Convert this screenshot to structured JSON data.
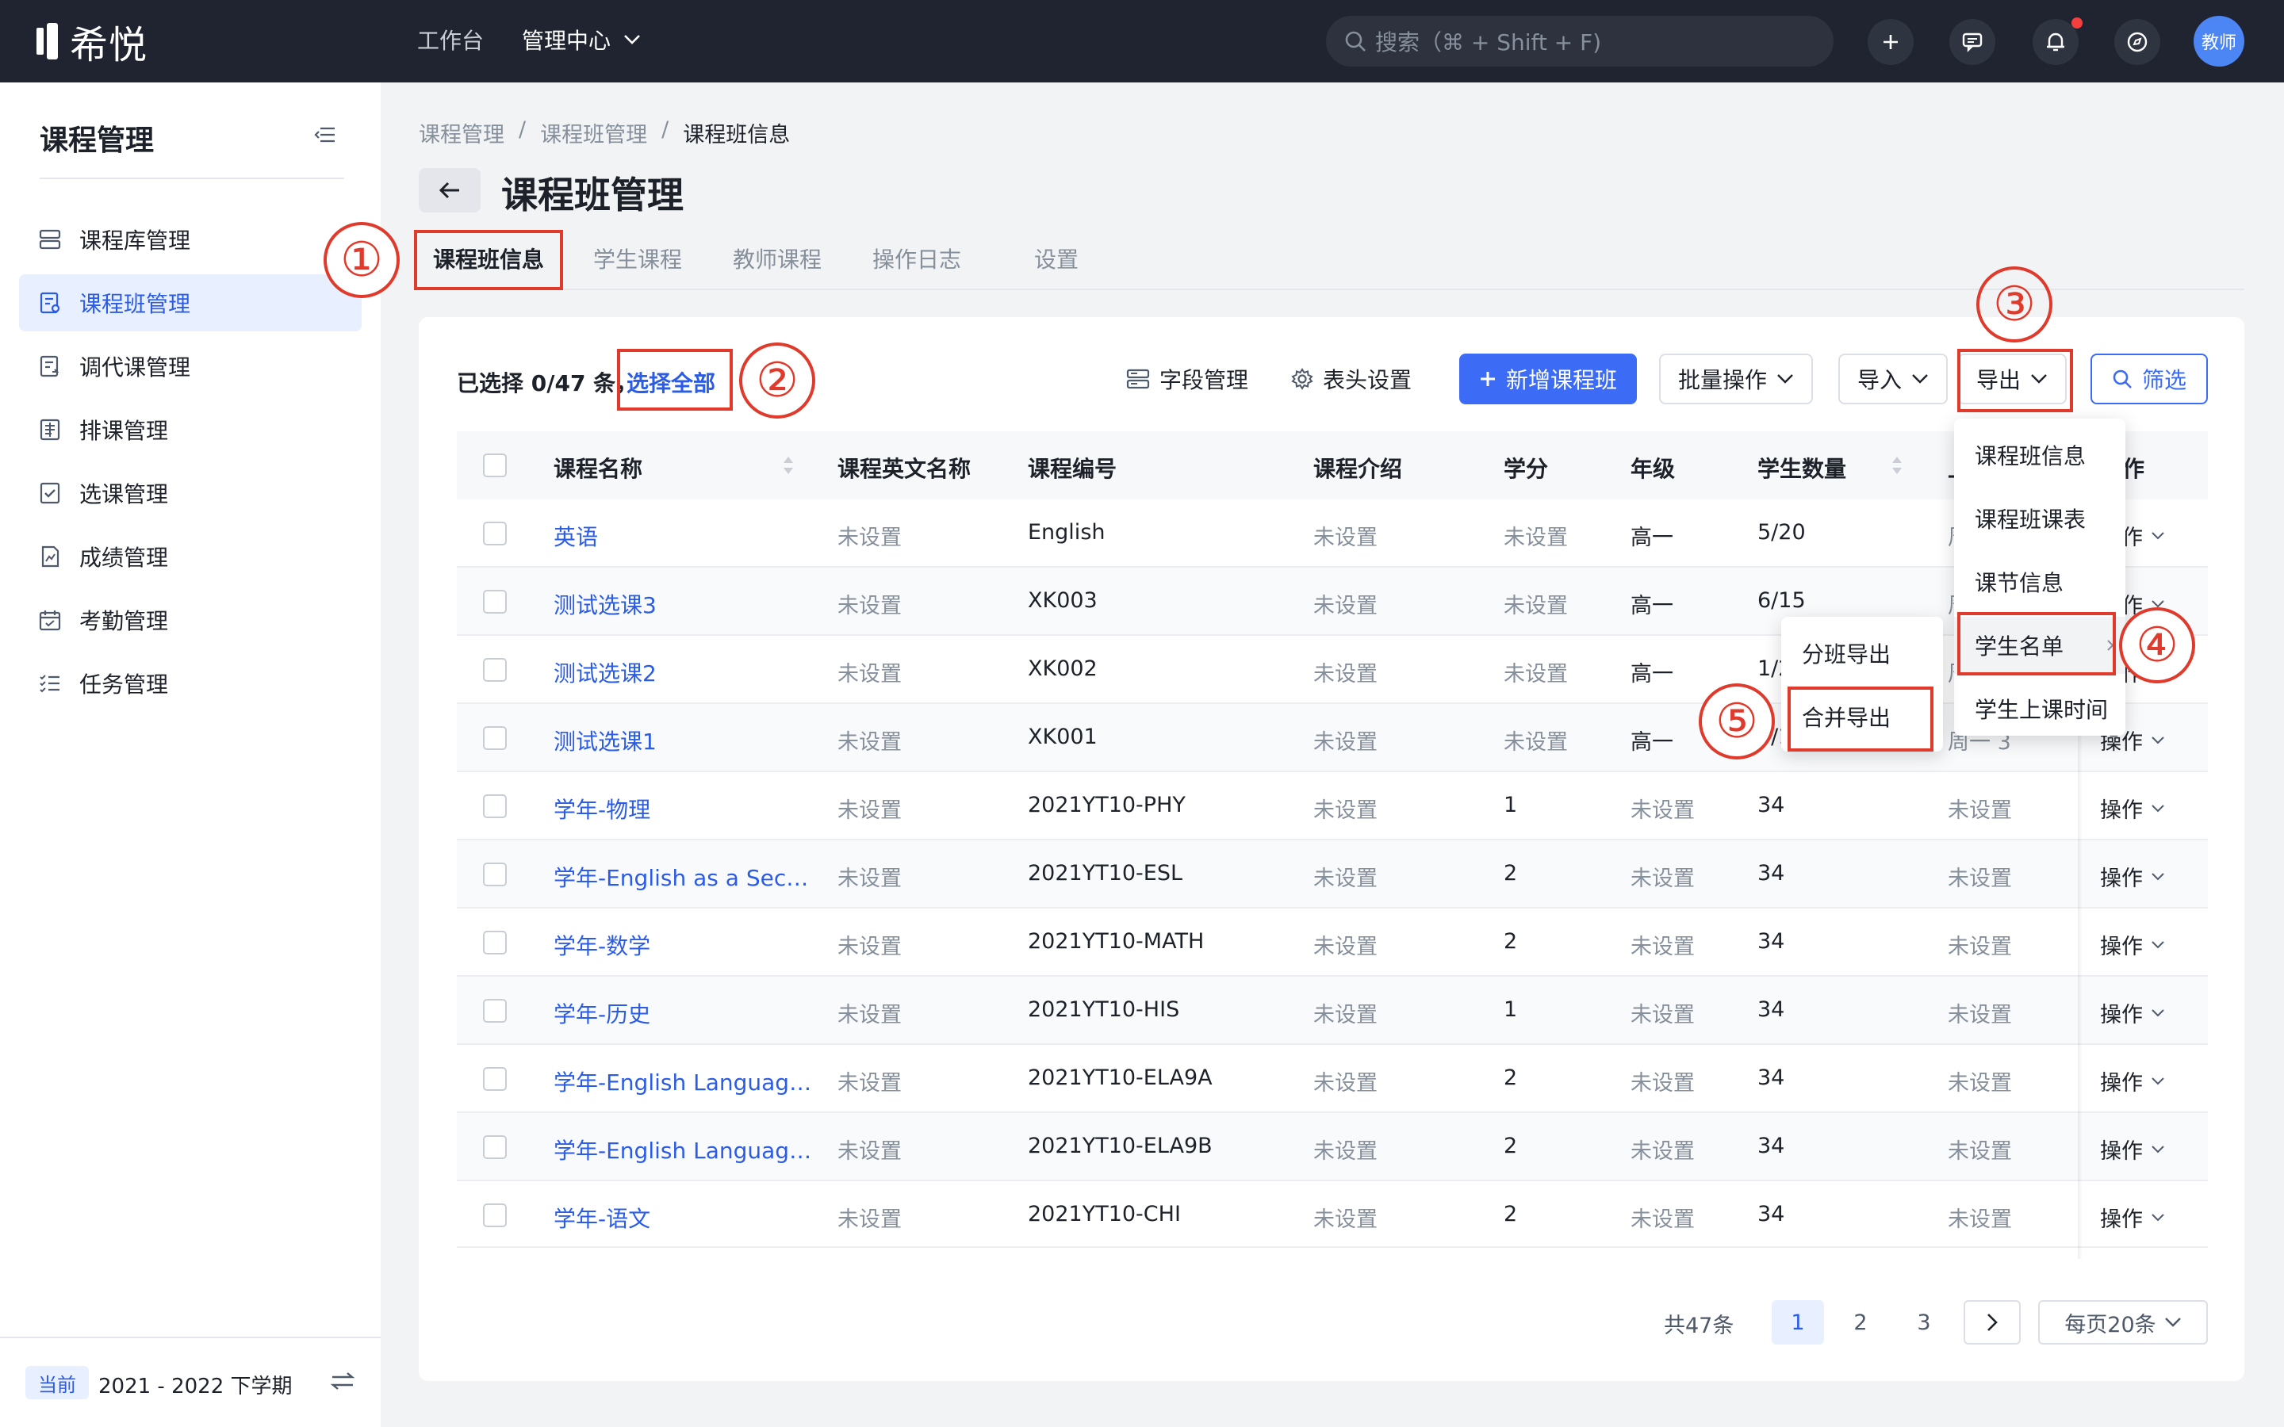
{
  "app": {
    "logo_text": "希悦"
  },
  "topbar": {
    "nav_workbench": "工作台",
    "nav_admin": "管理中心",
    "search_placeholder": "搜索（⌘ + Shift + F)",
    "avatar_text": "教师"
  },
  "sidebar": {
    "title": "课程管理",
    "items": [
      {
        "label": "课程库管理",
        "icon": "course-library-icon"
      },
      {
        "label": "课程班管理",
        "icon": "course-class-icon",
        "active": true
      },
      {
        "label": "调代课管理",
        "icon": "substitute-icon"
      },
      {
        "label": "排课管理",
        "icon": "schedule-icon"
      },
      {
        "label": "选课管理",
        "icon": "selection-icon"
      },
      {
        "label": "成绩管理",
        "icon": "grades-icon"
      },
      {
        "label": "考勤管理",
        "icon": "attendance-icon"
      },
      {
        "label": "任务管理",
        "icon": "tasks-icon"
      }
    ],
    "term_badge": "当前",
    "term": "2021 - 2022 下学期"
  },
  "breadcrumb": [
    "课程管理",
    "课程班管理",
    "课程班信息"
  ],
  "breadcrumb_sep": "/",
  "page_title": "课程班管理",
  "tabs": [
    "课程班信息",
    "学生课程",
    "教师课程",
    "操作日志",
    "设置"
  ],
  "toolbar": {
    "selected_info": "已选择 0/47 条，",
    "select_all": "选择全部",
    "field_manage": "字段管理",
    "header_settings": "表头设置",
    "new_class": "新增课程班",
    "batch_ops": "批量操作",
    "import": "导入",
    "export": "导出",
    "filter": "筛选"
  },
  "table": {
    "columns": [
      "课程名称",
      "课程英文名称",
      "课程编号",
      "课程介绍",
      "学分",
      "年级",
      "学生数量",
      "上",
      "操作"
    ],
    "rows": [
      {
        "name": "英语",
        "en": "未设置",
        "code": "English",
        "intro": "未设置",
        "credit": "未设置",
        "grade": "高一",
        "students": "5/20",
        "extra": "周一 1",
        "op": "操作"
      },
      {
        "name": "测试选课3",
        "en": "未设置",
        "code": "XK003",
        "intro": "未设置",
        "credit": "未设置",
        "grade": "高一",
        "students": "6/15",
        "extra": "周一 1",
        "op": "操作"
      },
      {
        "name": "测试选课2",
        "en": "未设置",
        "code": "XK002",
        "intro": "未设置",
        "credit": "未设置",
        "grade": "高一",
        "students": "1/20",
        "extra": "周一 1",
        "op": "操作"
      },
      {
        "name": "测试选课1",
        "en": "未设置",
        "code": "XK001",
        "intro": "未设置",
        "credit": "未设置",
        "grade": "高一",
        "students": "0/10",
        "extra": "周一 3",
        "op": "操作"
      },
      {
        "name": "学年-物理",
        "en": "未设置",
        "code": "2021YT10-PHY",
        "intro": "未设置",
        "credit": "1",
        "grade": "未设置",
        "students": "34",
        "extra": "未设置",
        "op": "操作"
      },
      {
        "name": "学年-English as a Sec…",
        "en": "未设置",
        "code": "2021YT10-ESL",
        "intro": "未设置",
        "credit": "2",
        "grade": "未设置",
        "students": "34",
        "extra": "未设置",
        "op": "操作"
      },
      {
        "name": "学年-数学",
        "en": "未设置",
        "code": "2021YT10-MATH",
        "intro": "未设置",
        "credit": "2",
        "grade": "未设置",
        "students": "34",
        "extra": "未设置",
        "op": "操作"
      },
      {
        "name": "学年-历史",
        "en": "未设置",
        "code": "2021YT10-HIS",
        "intro": "未设置",
        "credit": "1",
        "grade": "未设置",
        "students": "34",
        "extra": "未设置",
        "op": "操作"
      },
      {
        "name": "学年-English Languag…",
        "en": "未设置",
        "code": "2021YT10-ELA9A",
        "intro": "未设置",
        "credit": "2",
        "grade": "未设置",
        "students": "34",
        "extra": "未设置",
        "op": "操作"
      },
      {
        "name": "学年-English Languag…",
        "en": "未设置",
        "code": "2021YT10-ELA9B",
        "intro": "未设置",
        "credit": "2",
        "grade": "未设置",
        "students": "34",
        "extra": "未设置",
        "op": "操作"
      },
      {
        "name": "学年-语文",
        "en": "未设置",
        "code": "2021YT10-CHI",
        "intro": "未设置",
        "credit": "2",
        "grade": "未设置",
        "students": "34",
        "extra": "未设置",
        "op": "操作"
      }
    ]
  },
  "export_menu": [
    "课程班信息",
    "课程班课表",
    "课节信息",
    "学生名单",
    "学生上课时间"
  ],
  "student_list_submenu": [
    "分班导出",
    "合并导出"
  ],
  "pagination": {
    "total": "共47条",
    "pages": [
      "1",
      "2",
      "3"
    ],
    "current": "1",
    "page_size": "每页20条"
  },
  "annotations": [
    "①",
    "②",
    "③",
    "④",
    "⑤"
  ],
  "colors": {
    "primary": "#3c6cf5",
    "annotation_red": "#e03a2c",
    "topbar": "#1f2430"
  }
}
